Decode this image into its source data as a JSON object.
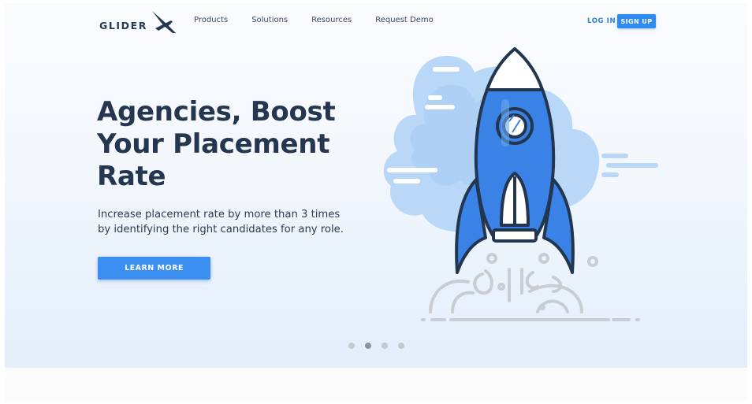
{
  "header": {
    "logo_text": "GLIDER",
    "nav": [
      "Products",
      "Solutions",
      "Resources",
      "Request Demo"
    ],
    "login_label": "LOG IN",
    "signup_label": "SIGN UP"
  },
  "hero": {
    "title_lines": [
      "Agencies, Boost",
      "Your Placement",
      "Rate"
    ],
    "subtitle_lines": [
      "Increase placement rate by more than 3 times",
      "by identifying the right candidates for any role."
    ],
    "cta_label": "LEARN MORE"
  },
  "carousel": {
    "slide_count": 4,
    "active_index": 1
  },
  "colors": {
    "brand_dark": "#253650",
    "accent_blue": "#2f8bf0",
    "rocket_blue": "#3b82e6",
    "cloud_blue": "#b5d3f6",
    "smoke_gray": "#c9cdd3"
  },
  "icons": {
    "logo": "glider-plane-icon",
    "illustration": "rocket-launch-illustration"
  }
}
